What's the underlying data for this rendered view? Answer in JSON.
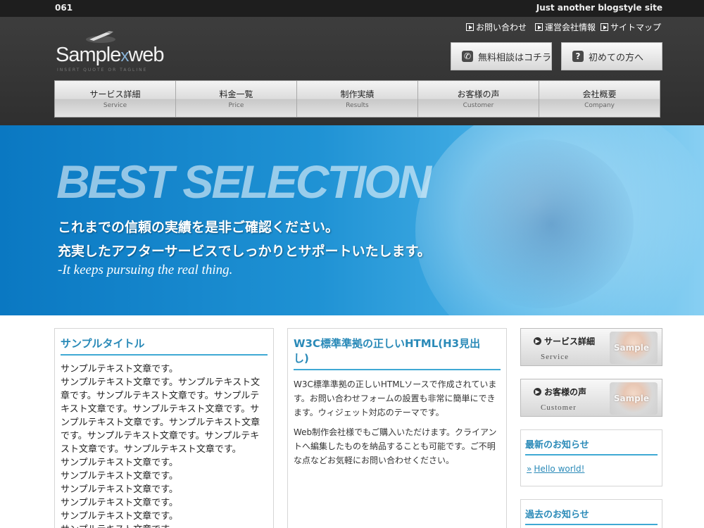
{
  "topbar": {
    "number": "061",
    "tagline": "Just another blogstyle site"
  },
  "logo": {
    "name_a": "Sample",
    "name_x": "x",
    "name_b": "web",
    "tagline": "INSERT QUOTE OR TAGLINE"
  },
  "utility_links": [
    {
      "label": "お問い合わせ"
    },
    {
      "label": "運営会社情報"
    },
    {
      "label": "サイトマップ"
    }
  ],
  "header_buttons": [
    {
      "label": "無料相談はコチラ",
      "icon": "phone-icon",
      "glyph": "✆"
    },
    {
      "label": "初めての方へ",
      "icon": "question-icon",
      "glyph": "?"
    }
  ],
  "nav": [
    {
      "jp": "サービス詳細",
      "en": "Service"
    },
    {
      "jp": "料金一覧",
      "en": "Price"
    },
    {
      "jp": "制作実績",
      "en": "Results"
    },
    {
      "jp": "お客様の声",
      "en": "Customer"
    },
    {
      "jp": "会社概要",
      "en": "Company"
    }
  ],
  "hero": {
    "headline": "BEST SELECTION",
    "line1": "これまでの信頼の実績を是非ご確認ください。",
    "line2": "充実したアフターサービスでしっかりとサポートいたします。",
    "line3": "-It keeps pursuing the real thing."
  },
  "col1": {
    "title": "サンプルタイトル",
    "text": "サンプルテキスト文章です。\nサンプルテキスト文章です。サンプルテキスト文章です。サンプルテキスト文章です。サンプルテキスト文章です。サンプルテキスト文章です。サンプルテキスト文章です。サンプルテキスト文章です。サンプルテキスト文章です。サンプルテキスト文章です。サンプルテキスト文章です。\nサンプルテキスト文章です。\nサンプルテキスト文章です。\nサンプルテキスト文章です。\nサンプルテキスト文章です。\nサンプルテキスト文章です。\nサンプルテキスト文章です。"
  },
  "col2": {
    "title": "W3C標準準拠の正しいHTML(H3見出し)",
    "p1": "W3C標準準拠の正しいHTMLソースで作成されています。お問い合わせフォームの設置も非常に簡単にできます。ウィジェット対応のテーマです。",
    "p2": "Web制作会社様でもご購入いただけます。クライアントへ編集したものを納品することも可能です。ご不明な点などお気軽にお問い合わせください。"
  },
  "sidebar": {
    "banners": [
      {
        "title": "サービス詳細",
        "en": "Service",
        "sample": "Sample"
      },
      {
        "title": "お客様の声",
        "en": "Customer",
        "sample": "Sample"
      }
    ],
    "latest": {
      "title": "最新のお知らせ",
      "link": "Hello world!"
    },
    "past": {
      "title": "過去のお知らせ"
    }
  }
}
